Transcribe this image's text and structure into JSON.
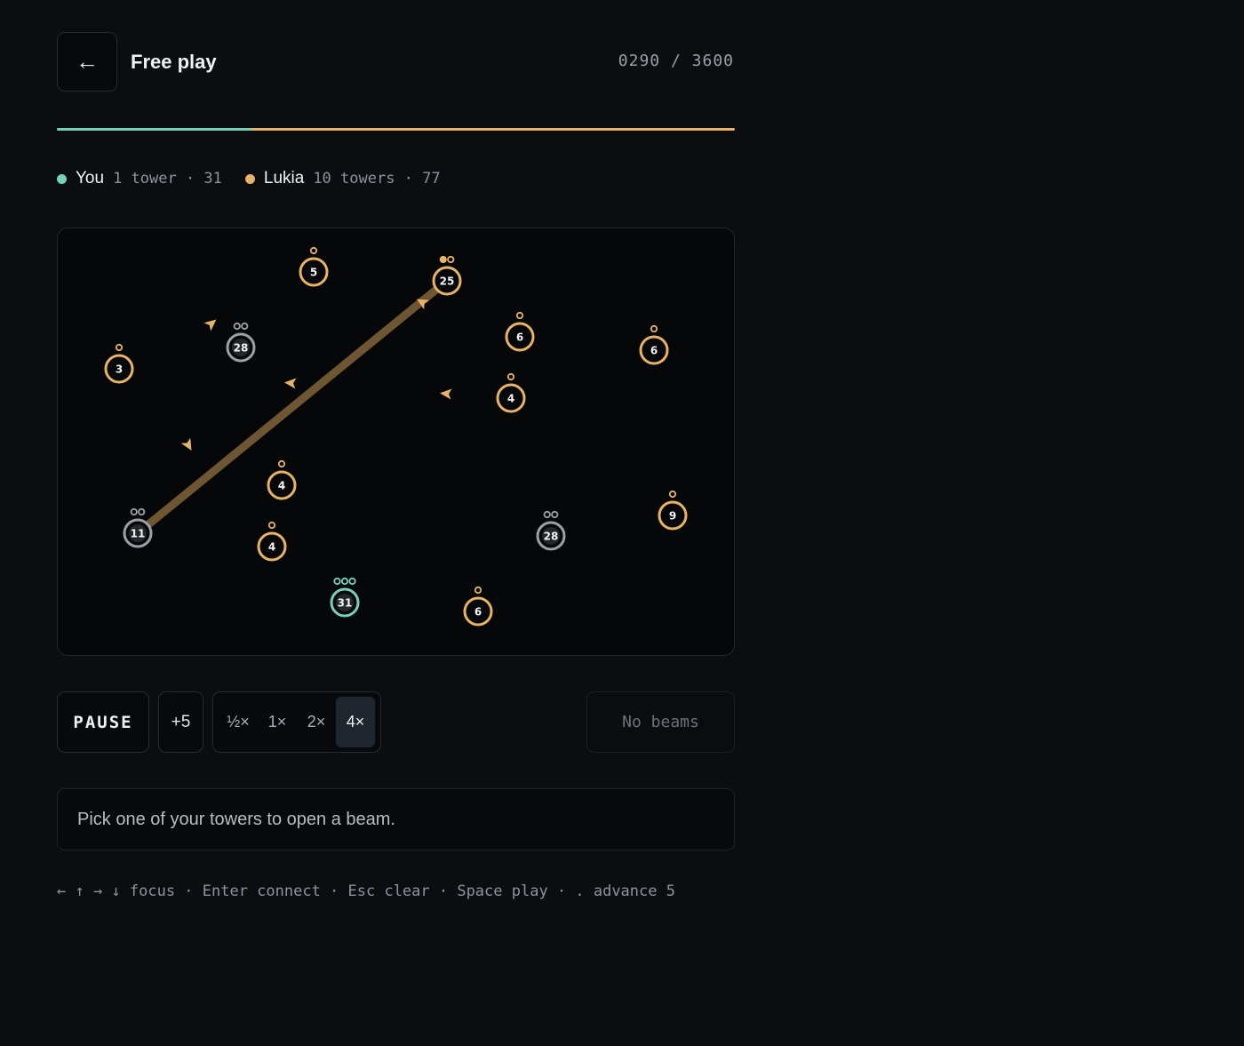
{
  "header": {
    "back_icon": "←",
    "title": "Free play",
    "timer": "0290 / 3600"
  },
  "progress": {
    "player_fraction": 0.287,
    "player_color": "#76d1b6",
    "opponent_color": "#e7b466"
  },
  "players": [
    {
      "name": "You",
      "stat": "1 tower · 31",
      "color": "#76d1b6"
    },
    {
      "name": "Lukia",
      "stat": "10 towers · 77",
      "color": "#e7b466"
    }
  ],
  "board": {
    "colors": {
      "you": "#76d1b6",
      "enemy": "#e7b466",
      "neutral": "#9ba1a9",
      "beam": "#6e5633"
    },
    "towers": [
      {
        "owner": "enemy",
        "value": "5",
        "pips": 1,
        "filled": 0
      },
      {
        "owner": "enemy",
        "value": "25",
        "pips": 2,
        "filled": 1
      },
      {
        "owner": "neutral",
        "value": "28",
        "pips": 2,
        "filled": 0
      },
      {
        "owner": "enemy",
        "value": "3",
        "pips": 1,
        "filled": 0
      },
      {
        "owner": "enemy",
        "value": "6",
        "pips": 1,
        "filled": 0
      },
      {
        "owner": "enemy",
        "value": "6",
        "pips": 1,
        "filled": 0
      },
      {
        "owner": "enemy",
        "value": "4",
        "pips": 1,
        "filled": 0
      },
      {
        "owner": "enemy",
        "value": "4",
        "pips": 1,
        "filled": 0
      },
      {
        "owner": "neutral",
        "value": "11",
        "pips": 2,
        "filled": 0
      },
      {
        "owner": "enemy",
        "value": "4",
        "pips": 1,
        "filled": 0
      },
      {
        "owner": "neutral",
        "value": "28",
        "pips": 2,
        "filled": 0
      },
      {
        "owner": "enemy",
        "value": "9",
        "pips": 1,
        "filled": 0
      },
      {
        "owner": "you",
        "value": "31",
        "pips": 3,
        "filled": 0
      },
      {
        "owner": "enemy",
        "value": "6",
        "pips": 1,
        "filled": 0
      }
    ],
    "beams": [
      {
        "from": 8,
        "to": 1,
        "owner": "enemy"
      }
    ],
    "units": [
      {
        "owner": "enemy"
      },
      {
        "owner": "enemy"
      },
      {
        "owner": "enemy"
      },
      {
        "owner": "enemy"
      },
      {
        "owner": "enemy"
      }
    ]
  },
  "controls": {
    "pause_label": "PAUSE",
    "advance_label": "+5",
    "speeds": [
      "½×",
      "1×",
      "2×",
      "4×"
    ],
    "active_speed": "4×",
    "beams_label": "No beams"
  },
  "hint": "Pick one of your towers to open a beam.",
  "shortcuts": "← ↑ → ↓ focus · Enter connect · Esc clear · Space play · . advance 5"
}
